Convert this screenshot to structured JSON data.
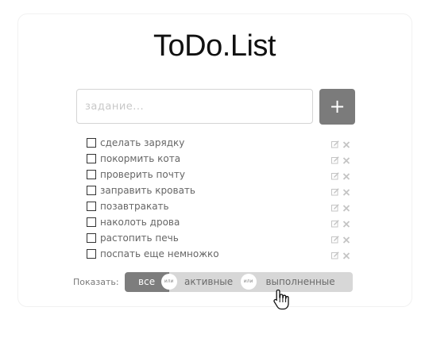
{
  "app": {
    "title": "ToDo.List"
  },
  "new_task": {
    "placeholder": "задание...",
    "value": "",
    "add_label": "+"
  },
  "todos": [
    {
      "label": "сделать зарядку",
      "done": false
    },
    {
      "label": "покормить кота",
      "done": false
    },
    {
      "label": "проверить почту",
      "done": false
    },
    {
      "label": "заправить кровать",
      "done": false
    },
    {
      "label": "позавтракать",
      "done": false
    },
    {
      "label": "наколоть дрова",
      "done": false
    },
    {
      "label": "растопить печь",
      "done": false
    },
    {
      "label": "поспать еще немножко",
      "done": false
    }
  ],
  "filter": {
    "label": "Показать:",
    "options": [
      "все",
      "активные",
      "выполненные"
    ],
    "selected": "все",
    "separator": "или"
  },
  "icons": {
    "edit": "edit-icon",
    "delete": "close-icon",
    "cursor": "hand-pointer-icon"
  },
  "colors": {
    "accent": "#7b7b7b",
    "filter_inactive": "#d7d7d7",
    "text_muted": "#666666",
    "icon": "#c4c4c4"
  }
}
